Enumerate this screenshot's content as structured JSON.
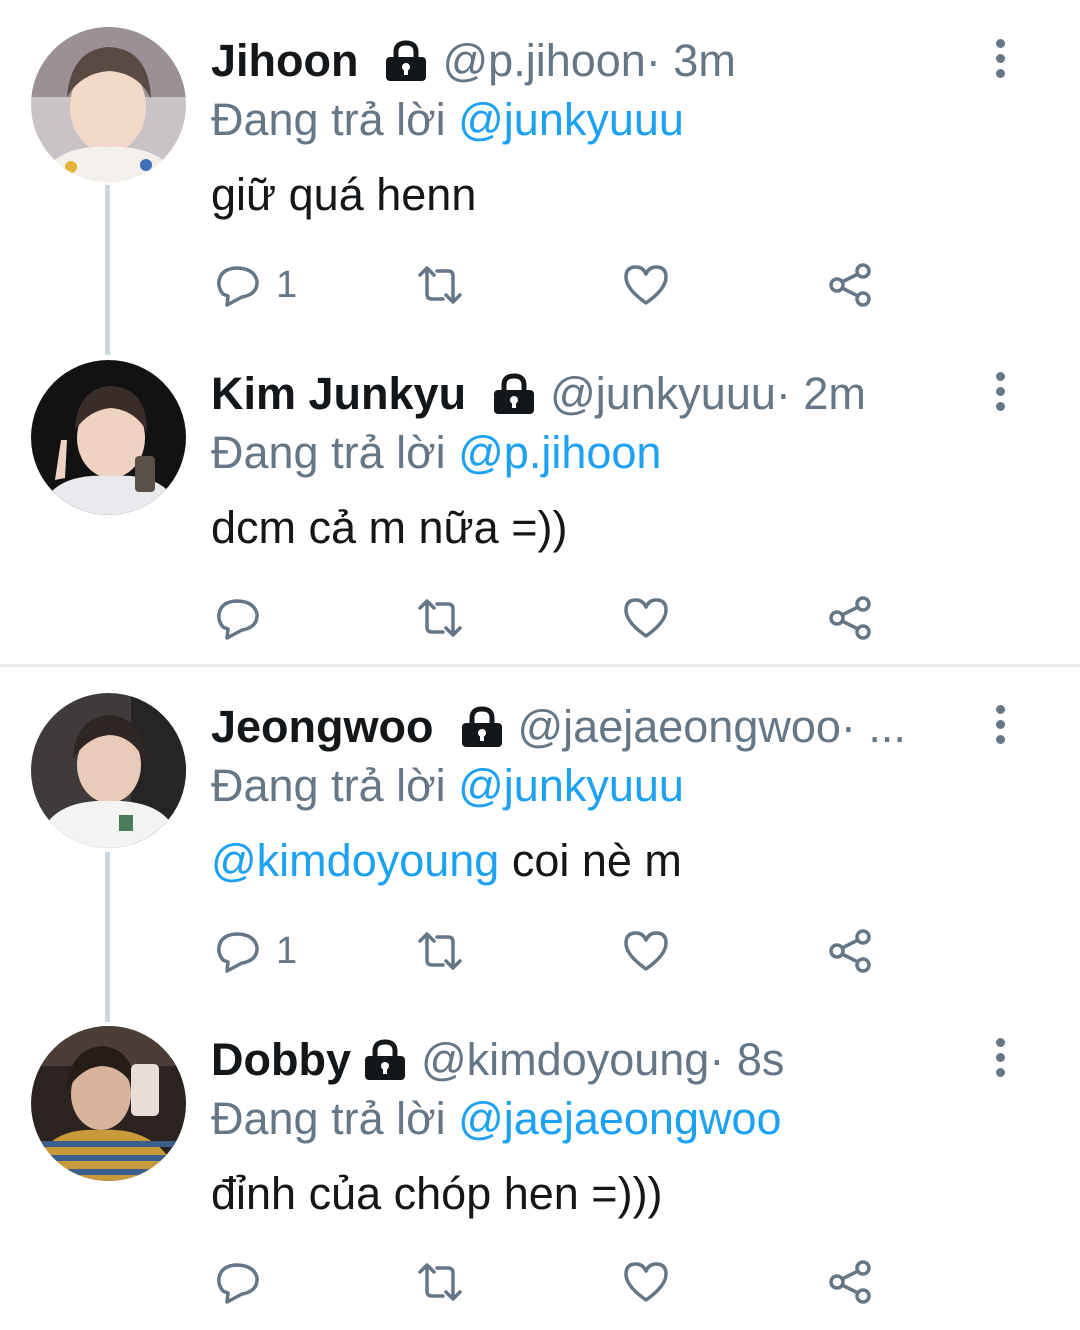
{
  "colors": {
    "link": "#1da1f2",
    "secondary_text": "#657786",
    "primary_text": "#14171a",
    "thread_line": "#ccd6dd",
    "divider": "#e6ecf0"
  },
  "icons": {
    "protected": "lock-icon",
    "more": "more-vertical-icon",
    "reply": "reply-icon",
    "retweet": "retweet-icon",
    "like": "heart-icon",
    "share": "share-icon"
  },
  "tweets": [
    {
      "name": "Jihoon",
      "handle": "@p.jihoon",
      "meta": " · 3m",
      "reply_prefix": "Đang trả lời",
      "reply_to": "@junkyuuu",
      "text_mention": "",
      "text": "giữ quá henn",
      "reply_count": "1"
    },
    {
      "name": "Kim Junkyu",
      "handle": "@junkyuuu",
      "meta": " · 2m",
      "reply_prefix": "Đang trả lời",
      "reply_to": "@p.jihoon",
      "text_mention": "",
      "text": "dcm cả m nữa =))",
      "reply_count": ""
    },
    {
      "name": "Jeongwoo",
      "handle": "@jaejaeongwoo",
      "meta": " · ...",
      "reply_prefix": "Đang trả lời",
      "reply_to": "@junkyuuu",
      "text_mention": "@kimdoyoung",
      "text": " coi nè m",
      "reply_count": "1"
    },
    {
      "name": "Dobby",
      "handle": "@kimdoyoung",
      "meta": " · 8s",
      "reply_prefix": "Đang trả lời",
      "reply_to": "@jaejaeongwoo",
      "text_mention": "",
      "text": "đỉnh của chóp hen =)))",
      "reply_count": ""
    }
  ]
}
